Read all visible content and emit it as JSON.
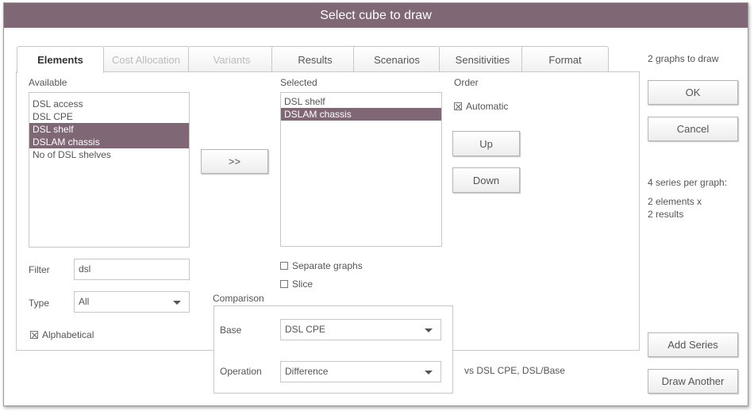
{
  "window": {
    "title": "Select cube to draw"
  },
  "tabs": [
    {
      "label": "Elements",
      "state": "active"
    },
    {
      "label": "Cost Allocation",
      "state": "disabled"
    },
    {
      "label": "Variants",
      "state": "disabled"
    },
    {
      "label": "Results",
      "state": "normal"
    },
    {
      "label": "Scenarios",
      "state": "normal"
    },
    {
      "label": "Sensitivities",
      "state": "normal"
    },
    {
      "label": "Format",
      "state": "normal"
    }
  ],
  "available": {
    "label": "Available",
    "items": [
      {
        "text": "DSL access",
        "selected": false
      },
      {
        "text": "DSL CPE",
        "selected": false
      },
      {
        "text": "DSL shelf",
        "selected": true
      },
      {
        "text": "DSLAM chassis",
        "selected": true
      },
      {
        "text": "No of DSL shelves",
        "selected": false
      }
    ]
  },
  "transfer_button": ">>",
  "selected": {
    "label": "Selected",
    "items": [
      {
        "text": "DSL shelf",
        "selected": false
      },
      {
        "text": "DSLAM chassis",
        "selected": true
      }
    ]
  },
  "order": {
    "label": "Order",
    "automatic_label": "Automatic",
    "automatic_checked": true,
    "up_label": "Up",
    "down_label": "Down"
  },
  "filter": {
    "label": "Filter",
    "value": "dsl"
  },
  "type": {
    "label": "Type",
    "value": "All"
  },
  "alphabetical": {
    "label": "Alphabetical",
    "checked": true
  },
  "separate_graphs": {
    "label": "Separate graphs",
    "checked": false
  },
  "slice": {
    "label": "Slice",
    "checked": false
  },
  "comparison": {
    "label": "Comparison",
    "base_label": "Base",
    "base_value": "DSL CPE",
    "operation_label": "Operation",
    "operation_value": "Difference",
    "summary": "vs DSL CPE, DSL/Base"
  },
  "sidebar": {
    "graphs_to_draw": "2 graphs to draw",
    "ok_label": "OK",
    "cancel_label": "Cancel",
    "series_per_graph": "4 series per graph:",
    "elements_line": "2 elements x",
    "results_line": "2 results",
    "add_series_label": "Add Series",
    "draw_another_label": "Draw Another"
  },
  "colors": {
    "accent": "#7f6775",
    "border": "#c8c8c8"
  }
}
